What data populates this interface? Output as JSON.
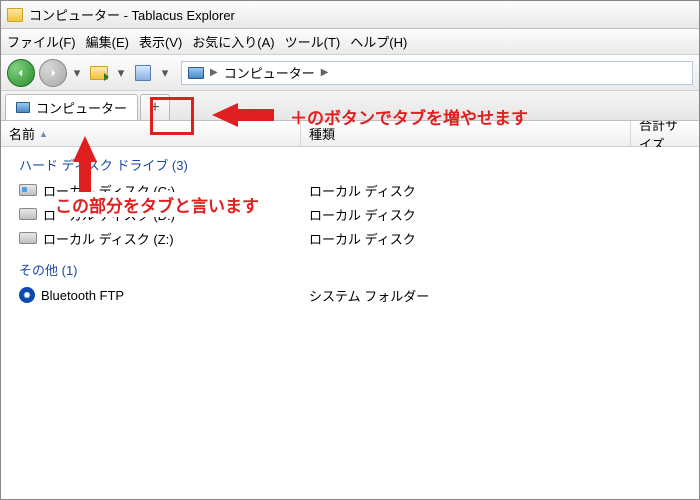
{
  "window": {
    "title": "コンピューター - Tablacus Explorer"
  },
  "menu": {
    "file": "ファイル(F)",
    "edit": "編集(E)",
    "view": "表示(V)",
    "favorites": "お気に入り(A)",
    "tools": "ツール(T)",
    "help": "ヘルプ(H)"
  },
  "breadcrumb": {
    "location": "コンピューター"
  },
  "tabs": {
    "active_label": "コンピューター",
    "plus": "+"
  },
  "columns": {
    "name": "名前",
    "type": "種類",
    "total_size": "合計サイズ"
  },
  "groups": {
    "hdd": "ハード ディスク ドライブ (3)",
    "other": "その他 (1)"
  },
  "rows": {
    "c": {
      "name": "ローカル ディスク (C:)",
      "type": "ローカル ディスク"
    },
    "d": {
      "name": "ローカル ディスク (D:)",
      "type": "ローカル ディスク"
    },
    "z": {
      "name": "ローカル ディスク (Z:)",
      "type": "ローカル ディスク"
    },
    "bt": {
      "name": "Bluetooth FTP",
      "type": "システム フォルダー"
    }
  },
  "annotations": {
    "plus_note": "＋のボタンでタブを増やせます",
    "tab_note": "この部分をタブと言います"
  }
}
